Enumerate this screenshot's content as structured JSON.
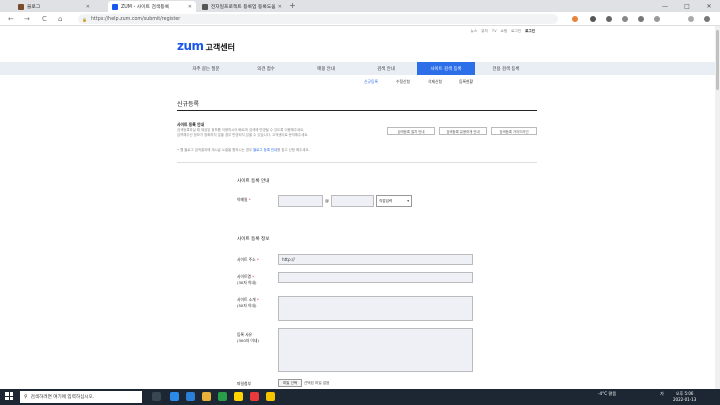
{
  "browser": {
    "tabs": [
      {
        "title": "블로그"
      },
      {
        "title": "ZUM - 사이트 검색등록"
      },
      {
        "title": "전자일프로젝트 등록업 등록도움말 1..."
      }
    ],
    "new_tab": "+",
    "url": "https://help.zum.com/submit/register",
    "nav_back": "←",
    "nav_forward": "→",
    "nav_reload": "C",
    "nav_home": "⌂",
    "lock": "🔒",
    "win_min": "—",
    "win_max": "□",
    "win_close": "✕"
  },
  "page": {
    "util_links": [
      "뉴스",
      "뮤직",
      "TV",
      "쇼핑",
      "로그인",
      "로그인"
    ],
    "logo_zum": "zum",
    "logo_cc": "고객센터",
    "gnb": [
      {
        "label": "자주 묻는 질문"
      },
      {
        "label": "의견 접수"
      },
      {
        "label": "매핑 안내"
      },
      {
        "label": "검색 안내"
      },
      {
        "label": "사이트 검색 등록",
        "active": true
      },
      {
        "label": "전용 검색 등록"
      }
    ],
    "lnb": [
      "신규등록",
      "수정신청",
      "삭제신청",
      "등록현황"
    ],
    "heading": "신규등록",
    "info": {
      "title": "사이트 등록 안내",
      "lines": [
        "검색등록하실 때 제공된 정보를 이용하시어 빠르게 검색에 반영될 수 있도록 이용해주세요.",
        "입력해주신 정보가 정확하지 않을 경우 반영되지 않을 수 있습니다. 고객센터로 문의해주세요."
      ],
      "buttons": [
        "검색등록 절차 안내",
        "검색등록 유용하게 안내",
        "검색등록 가이드라인"
      ],
      "note_prefix": "• 웹 블로그 검색결과에 게시글 노출을 원하시는 경우 ",
      "note_link": "블로그 등록 안내",
      "note_suffix": "를 참고 신청 해주세요."
    },
    "section1": {
      "title": "사이트 등록 안내",
      "email_label": "이메일",
      "required": "*",
      "at": "@",
      "email_select": "직접입력"
    },
    "section2": {
      "title": "사이트 등록 정보",
      "url_label": "사이트 주소",
      "url_value": "http://",
      "name_label": "사이트명",
      "name_hint": "(30자 이내)",
      "desc_label": "사이트 소개",
      "desc_hint": "(50자 이내)",
      "reason_label": "등록 사유",
      "reason_hint": "(300자 이내)",
      "file_label": "파일첨부",
      "file_button": "파일 선택",
      "file_status": "선택된 파일 없음"
    }
  },
  "taskbar": {
    "search_placeholder": "검색하려면 여기에 입력하십시오.",
    "weather": "-4°C 맑음",
    "lang": "가",
    "time": "오후 5:06",
    "date": "2022-01-13"
  },
  "colors": {
    "accent": "#2d6fe8",
    "logo": "#1a57f0",
    "taskbar": "#1c2733"
  }
}
